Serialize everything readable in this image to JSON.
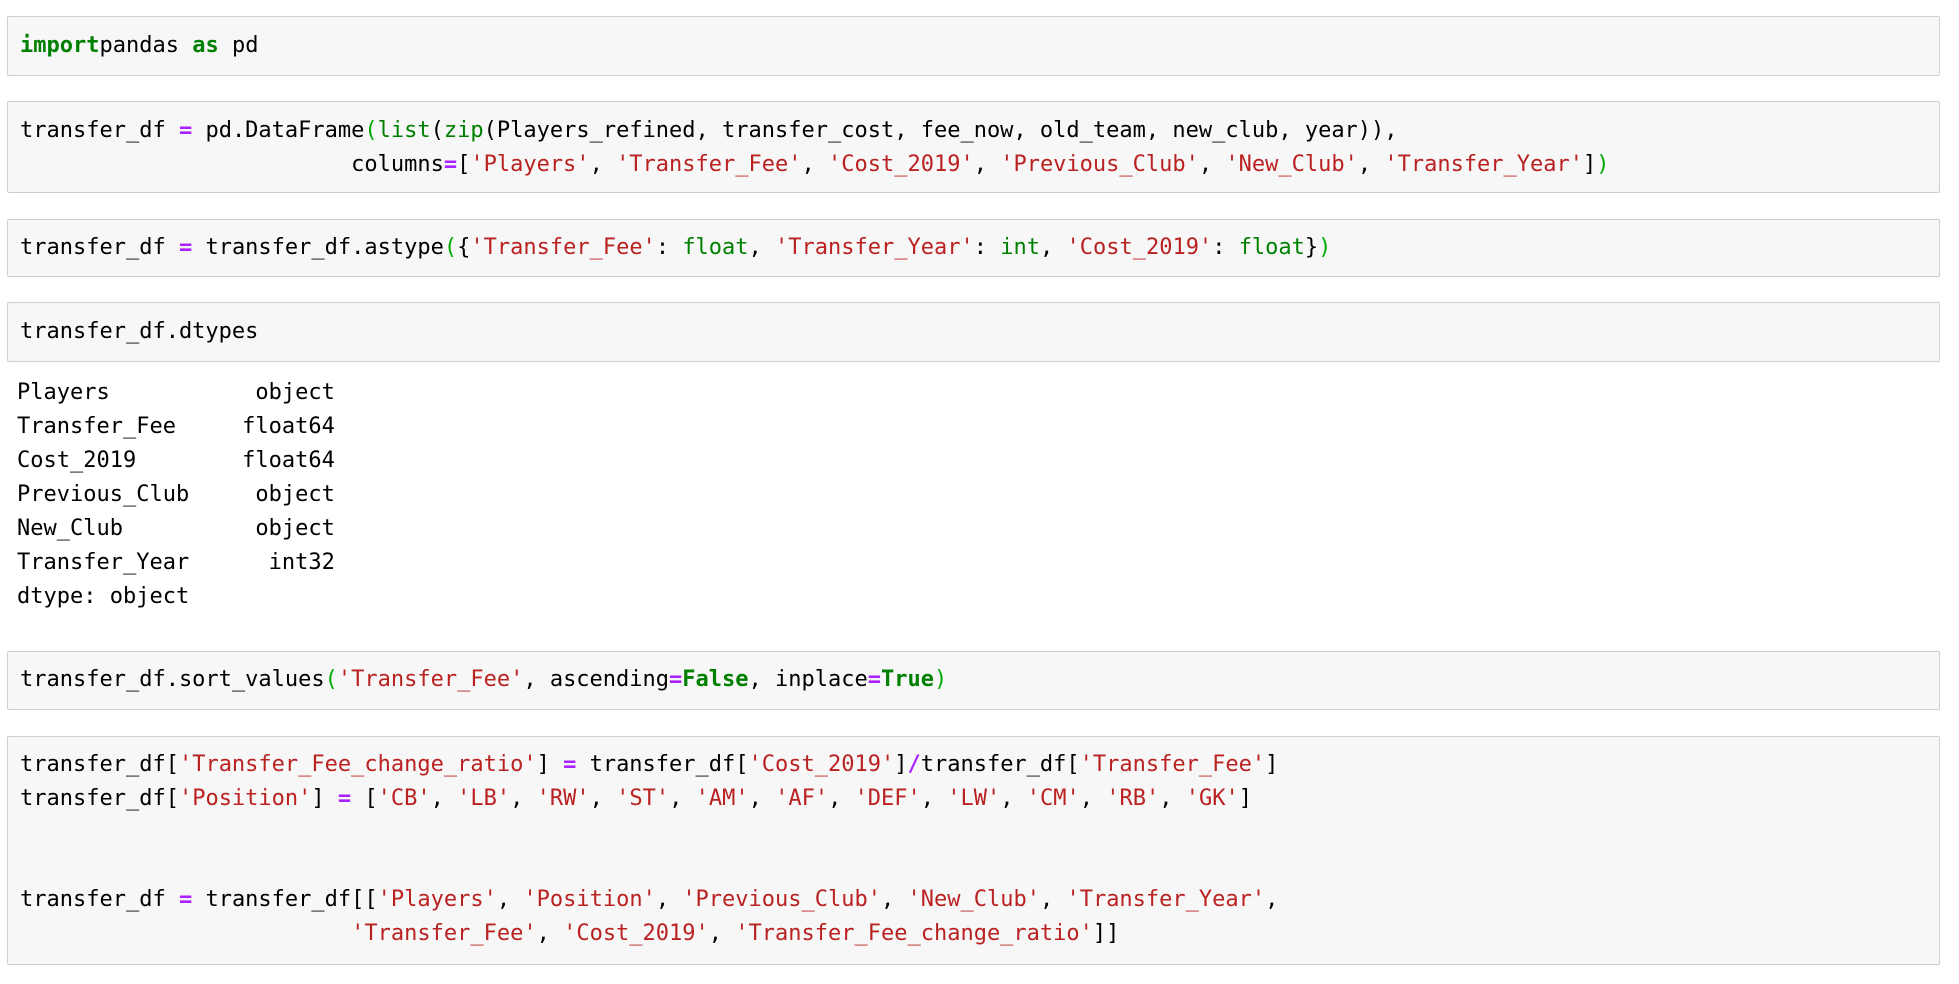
{
  "cells": [
    {
      "id": "import",
      "code": [
        [
          [
            "kw",
            "import"
          ],
          [
            "",
            "pandas "
          ],
          [
            "kw",
            "as"
          ],
          [
            "",
            " pd"
          ]
        ]
      ]
    },
    {
      "id": "dataframe",
      "code": [
        [
          [
            "",
            "transfer_df "
          ],
          [
            "op",
            "="
          ],
          [
            "",
            " pd.DataFrame"
          ],
          [
            "pn",
            "("
          ],
          [
            "bi",
            "list"
          ],
          [
            "",
            "("
          ],
          [
            "bi",
            "zip"
          ],
          [
            "",
            "(Players_refined, transfer_cost, fee_now, old_team, new_club, year)),"
          ]
        ],
        [
          [
            "",
            "                         columns"
          ],
          [
            "op",
            "="
          ],
          [
            "",
            "["
          ],
          [
            "st",
            "'Players'"
          ],
          [
            "",
            ", "
          ],
          [
            "st",
            "'Transfer_Fee'"
          ],
          [
            "",
            ", "
          ],
          [
            "st",
            "'Cost_2019'"
          ],
          [
            "",
            ", "
          ],
          [
            "st",
            "'Previous_Club'"
          ],
          [
            "",
            ", "
          ],
          [
            "st",
            "'New_Club'"
          ],
          [
            "",
            ", "
          ],
          [
            "st",
            "'Transfer_Year'"
          ],
          [
            "",
            "]"
          ],
          [
            "pn",
            ")"
          ]
        ]
      ]
    },
    {
      "id": "astype",
      "code": [
        [
          [
            "",
            "transfer_df "
          ],
          [
            "op",
            "="
          ],
          [
            "",
            " transfer_df.astype"
          ],
          [
            "pn",
            "("
          ],
          [
            "",
            "{"
          ],
          [
            "st",
            "'Transfer_Fee'"
          ],
          [
            "",
            ": "
          ],
          [
            "bi",
            "float"
          ],
          [
            "",
            ", "
          ],
          [
            "st",
            "'Transfer_Year'"
          ],
          [
            "",
            ": "
          ],
          [
            "bi",
            "int"
          ],
          [
            "",
            ", "
          ],
          [
            "st",
            "'Cost_2019'"
          ],
          [
            "",
            ": "
          ],
          [
            "bi",
            "float"
          ],
          [
            "",
            "}"
          ],
          [
            "pn",
            ")"
          ]
        ]
      ]
    },
    {
      "id": "dtypes",
      "code": [
        [
          [
            "",
            "transfer_df.dtypes"
          ]
        ]
      ]
    },
    {
      "id": "sort",
      "code": [
        [
          [
            "",
            "transfer_df.sort_values"
          ],
          [
            "pn",
            "("
          ],
          [
            "st",
            "'Transfer_Fee'"
          ],
          [
            "",
            ", ascending"
          ],
          [
            "op",
            "="
          ],
          [
            "kw",
            "False"
          ],
          [
            "",
            ", inplace"
          ],
          [
            "op",
            "="
          ],
          [
            "kw",
            "True"
          ],
          [
            "pn",
            ")"
          ]
        ]
      ]
    },
    {
      "id": "ratio",
      "code": [
        [
          [
            "",
            "transfer_df["
          ],
          [
            "st",
            "'Transfer_Fee_change_ratio'"
          ],
          [
            "",
            "] "
          ],
          [
            "op",
            "="
          ],
          [
            "",
            " transfer_df["
          ],
          [
            "st",
            "'Cost_2019'"
          ],
          [
            "",
            "]"
          ],
          [
            "op",
            "/"
          ],
          [
            "",
            "transfer_df["
          ],
          [
            "st",
            "'Transfer_Fee'"
          ],
          [
            "",
            "]"
          ]
        ],
        [
          [
            "",
            "transfer_df["
          ],
          [
            "st",
            "'Position'"
          ],
          [
            "",
            "] "
          ],
          [
            "op",
            "="
          ],
          [
            "",
            " ["
          ],
          [
            "st",
            "'CB'"
          ],
          [
            "",
            ", "
          ],
          [
            "st",
            "'LB'"
          ],
          [
            "",
            ", "
          ],
          [
            "st",
            "'RW'"
          ],
          [
            "",
            ", "
          ],
          [
            "st",
            "'ST'"
          ],
          [
            "",
            ", "
          ],
          [
            "st",
            "'AM'"
          ],
          [
            "",
            ", "
          ],
          [
            "st",
            "'AF'"
          ],
          [
            "",
            ", "
          ],
          [
            "st",
            "'DEF'"
          ],
          [
            "",
            ", "
          ],
          [
            "st",
            "'LW'"
          ],
          [
            "",
            ", "
          ],
          [
            "st",
            "'CM'"
          ],
          [
            "",
            ", "
          ],
          [
            "st",
            "'RB'"
          ],
          [
            "",
            ", "
          ],
          [
            "st",
            "'GK'"
          ],
          [
            "",
            "]"
          ]
        ],
        [],
        [],
        [
          [
            "",
            "transfer_df "
          ],
          [
            "op",
            "="
          ],
          [
            "",
            " transfer_df[["
          ],
          [
            "st",
            "'Players'"
          ],
          [
            "",
            ", "
          ],
          [
            "st",
            "'Position'"
          ],
          [
            "",
            ", "
          ],
          [
            "st",
            "'Previous_Club'"
          ],
          [
            "",
            ", "
          ],
          [
            "st",
            "'New_Club'"
          ],
          [
            "",
            ", "
          ],
          [
            "st",
            "'Transfer_Year'"
          ],
          [
            "",
            ","
          ]
        ],
        [
          [
            "",
            "                         "
          ],
          [
            "st",
            "'Transfer_Fee'"
          ],
          [
            "",
            ", "
          ],
          [
            "st",
            "'Cost_2019'"
          ],
          [
            "",
            ", "
          ],
          [
            "st",
            "'Transfer_Fee_change_ratio'"
          ],
          [
            "",
            "]]"
          ]
        ]
      ]
    }
  ],
  "dtypes_output": [
    "Players           object",
    "Transfer_Fee     float64",
    "Cost_2019        float64",
    "Previous_Club     object",
    "New_Club          object",
    "Transfer_Year      int32",
    "dtype: object"
  ]
}
